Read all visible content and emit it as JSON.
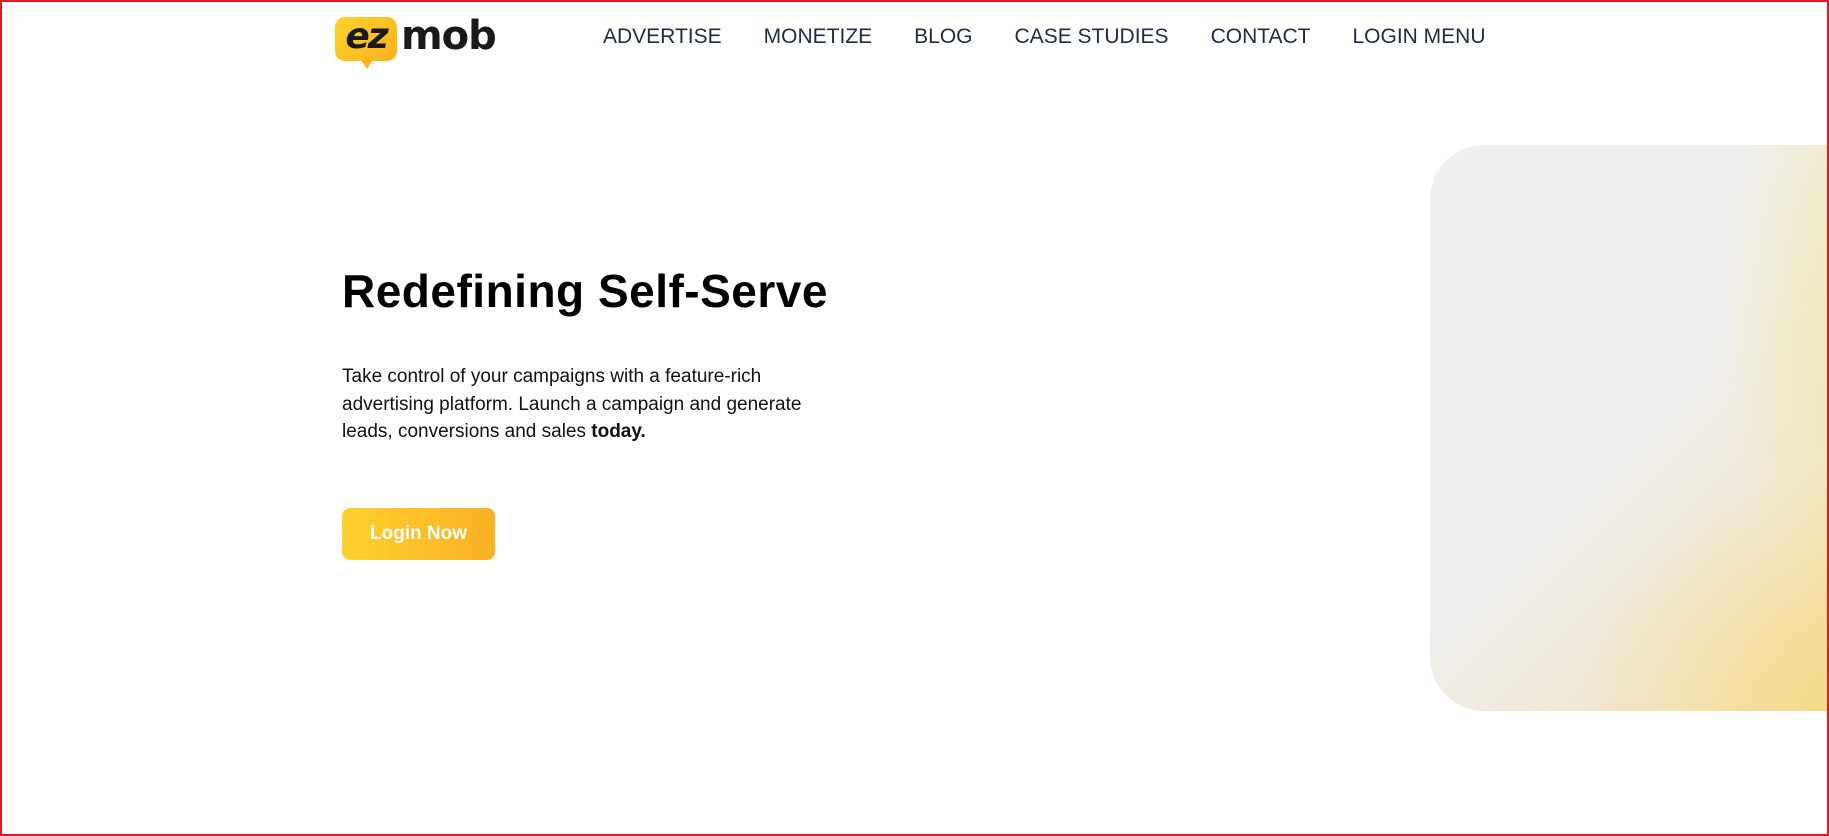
{
  "header": {
    "logo": {
      "part1": "ez",
      "part2": "mob"
    },
    "nav": [
      {
        "label": "ADVERTISE"
      },
      {
        "label": "MONETIZE"
      },
      {
        "label": "BLOG"
      },
      {
        "label": "CASE STUDIES"
      },
      {
        "label": "CONTACT"
      },
      {
        "label": "LOGIN MENU"
      }
    ]
  },
  "hero": {
    "title": "Redefining Self-Serve",
    "text": "Take control of your campaigns with a feature-rich advertising platform. Launch a campaign and generate leads, conversions and sales",
    "text_bold": "today.",
    "button_label": "Login Now"
  },
  "colors": {
    "brand_yellow": "#fed12f",
    "brand_orange": "#f9b023",
    "nav_text": "#1d2b48",
    "frame_border": "#e3191d"
  }
}
